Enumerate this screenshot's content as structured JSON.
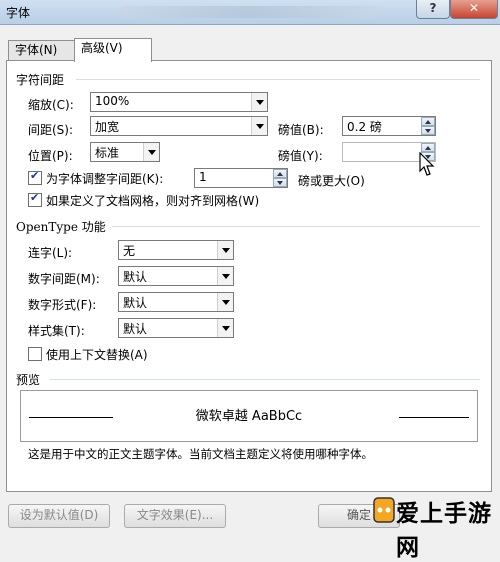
{
  "window": {
    "title": "字体",
    "help_label": "?",
    "close_label": "✕"
  },
  "tabs": [
    {
      "label": "字体(N)"
    },
    {
      "label": "高级(V)"
    }
  ],
  "char_spacing": {
    "section_title": "字符间距",
    "scale": {
      "label": "缩放(C):",
      "value": "100%"
    },
    "spacing": {
      "label": "间距(S):",
      "value": "加宽"
    },
    "spacing_amount": {
      "label": "磅值(B):",
      "value": "0.2 磅"
    },
    "position": {
      "label": "位置(P):",
      "value": "标准"
    },
    "position_amount": {
      "label": "磅值(Y):",
      "value": ""
    },
    "kerning": {
      "label": "为字体调整字间距(K):",
      "value": "1",
      "suffix": "磅或更大(O)",
      "checked": true
    },
    "snap_grid": {
      "label": "如果定义了文档网格，则对齐到网格(W)",
      "checked": true
    }
  },
  "opentype": {
    "section_title": "OpenType 功能",
    "ligatures": {
      "label": "连字(L):",
      "value": "无"
    },
    "number_spacing": {
      "label": "数字间距(M):",
      "value": "默认"
    },
    "number_forms": {
      "label": "数字形式(F):",
      "value": "默认"
    },
    "stylistic_sets": {
      "label": "样式集(T):",
      "value": "默认"
    },
    "contextual_alternates": {
      "label": "使用上下文替换(A)",
      "checked": false
    }
  },
  "preview": {
    "section_title": "预览",
    "sample_text": "微软卓越 AaBbCc",
    "description": "这是用于中文的正文主题字体。当前文档主题定义将使用哪种字体。"
  },
  "buttons": {
    "set_default": "设为默认值(D)",
    "text_effects": "文字效果(E)...",
    "ok": "确定"
  },
  "watermark": {
    "text": "爱上手游网"
  }
}
